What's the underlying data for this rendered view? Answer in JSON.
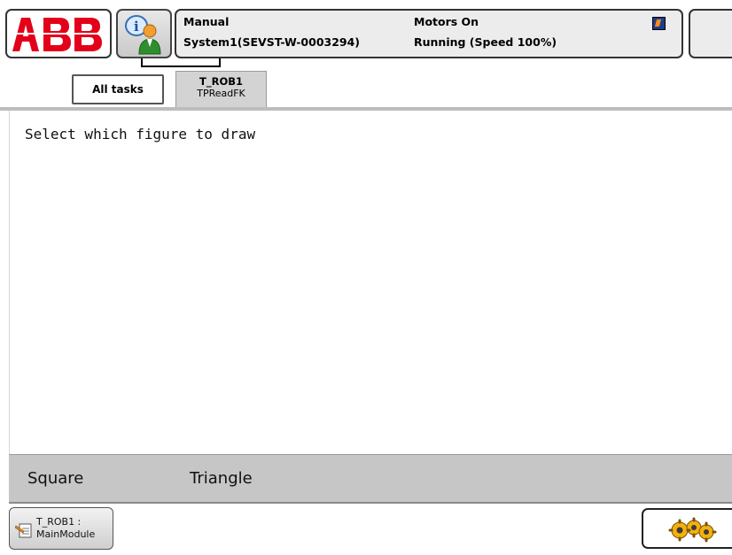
{
  "header": {
    "logo_text": "ABB",
    "operating_mode": "Manual",
    "system_name": "System1(SEVST-W-0003294)",
    "motor_state": "Motors On",
    "run_state": "Running (Speed 100%)"
  },
  "tabs": [
    {
      "label": "All tasks"
    },
    {
      "task": "T_ROB1",
      "program": "TPReadFK"
    }
  ],
  "content": {
    "prompt": "Select which figure to draw"
  },
  "function_keys": [
    "Square",
    "Triangle"
  ],
  "taskbar": {
    "task_line1": "T_ROB1 :",
    "task_line2": "MainModule"
  },
  "colors": {
    "abb_red": "#e2001a",
    "fkey_bar": "#c6c6c6",
    "tab_active": "#d3d3d3"
  },
  "icons": {
    "logo": "abb-logo",
    "info": "info-person-icon",
    "robot": "robot-status-icon",
    "program": "program-editor-icon",
    "quickset": "gears-icon"
  }
}
